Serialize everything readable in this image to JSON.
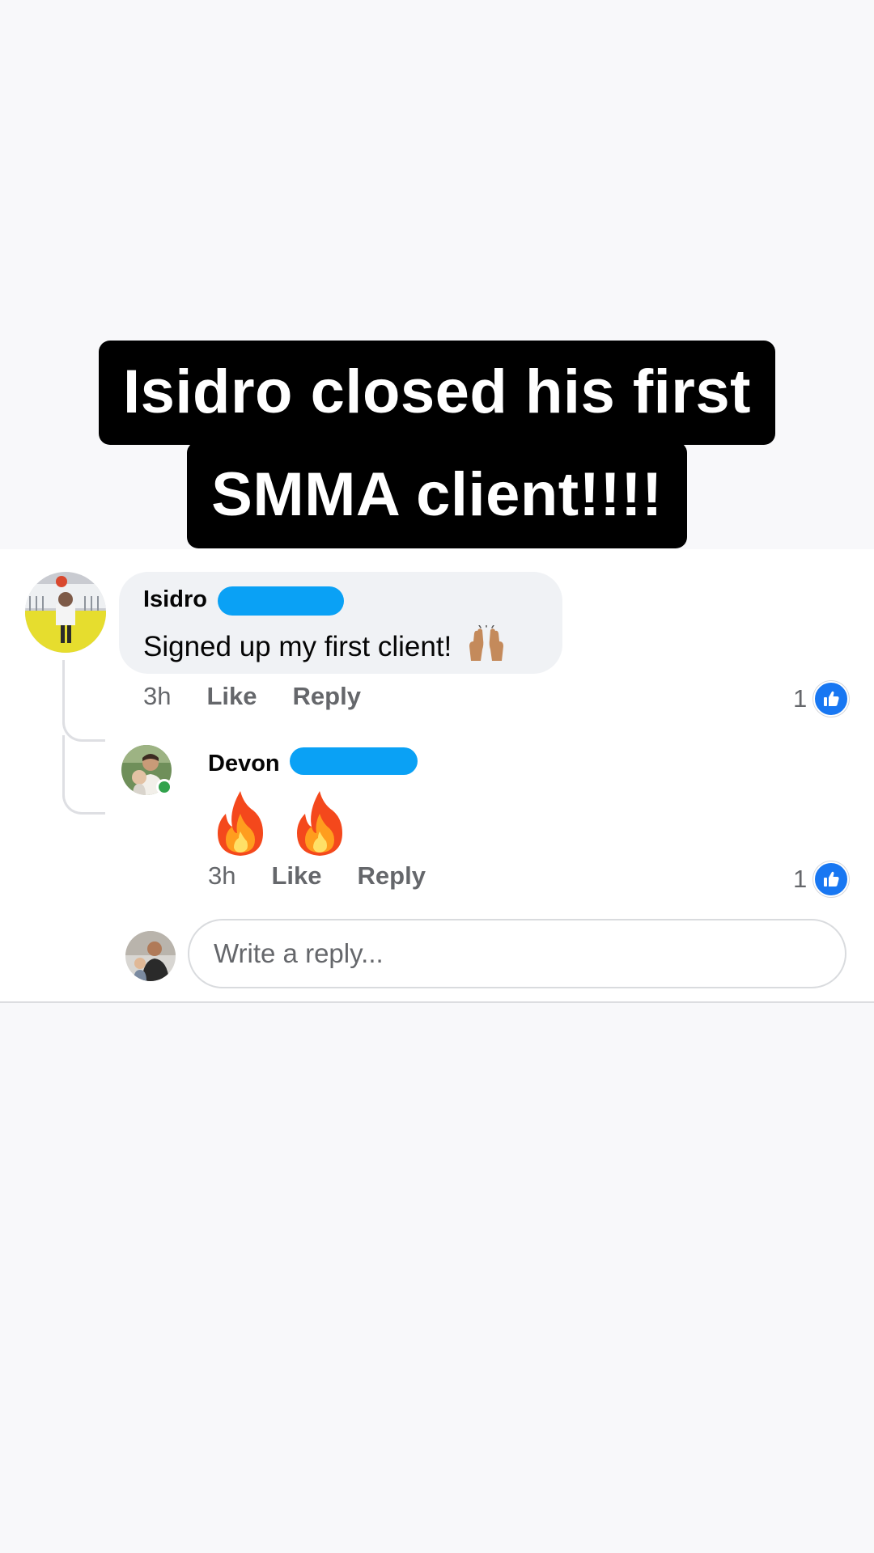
{
  "caption": {
    "line1": "Isidro closed his first",
    "line2": "SMMA client!!!!"
  },
  "comment": {
    "author": "Isidro",
    "text": "Signed up my first client!",
    "emoji": "raised-hands",
    "time": "3h",
    "like_label": "Like",
    "reply_label": "Reply",
    "like_count": "1"
  },
  "reply": {
    "author": "Devon",
    "content_emoji": [
      "fire",
      "fire"
    ],
    "time": "3h",
    "like_label": "Like",
    "reply_label": "Reply",
    "like_count": "1",
    "author_online": true
  },
  "reply_box": {
    "placeholder": "Write a reply..."
  },
  "colors": {
    "redaction": "#0aa1f5",
    "like_blue": "#1877f2",
    "online_green": "#31a24c",
    "caption_bg": "#000000",
    "bubble_bg": "#f0f2f5"
  }
}
